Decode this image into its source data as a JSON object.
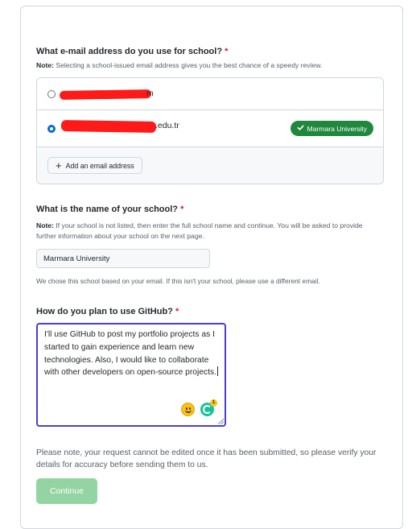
{
  "email_section": {
    "title": "What e-mail address do you use for school?",
    "required_mark": "*",
    "note_label": "Note:",
    "note_text": "Selecting a school-issued email address gives you the best chance of a speedy review.",
    "emails": [
      {
        "visible_text": "m",
        "selected": false
      },
      {
        "visible_text": ".edu.tr",
        "selected": true,
        "badge": "Marmara University"
      }
    ],
    "add_button_label": "Add an email address"
  },
  "school_section": {
    "title": "What is the name of your school?",
    "required_mark": "*",
    "note_label": "Note:",
    "note_text": "If your school is not listed, then enter the full school name and continue. You will be asked to provide further information about your school on the next page.",
    "school_value": "Marmara University",
    "helper_text": "We chose this school based on your email. If this isn't your school, please use a different email."
  },
  "usage_section": {
    "title": "How do you plan to use GitHub?",
    "required_mark": "*",
    "text_value": "I'll use GitHub to post my portfolio projects as I started to gain experience and learn new technologies. Also, I would like to collaborate with other developers on open-source projects.",
    "grammarly_count": "1"
  },
  "footer": {
    "note": "Please note, your request cannot be edited once it has been submitted, so please verify your details for accuracy before sending them to us.",
    "continue_label": "Continue"
  },
  "colors": {
    "accent_blue": "#0969da",
    "success_green": "#1f883d",
    "continue_disabled": "#94d3a2",
    "required_red": "#cf222e",
    "textarea_focus": "#4b3fcf"
  }
}
